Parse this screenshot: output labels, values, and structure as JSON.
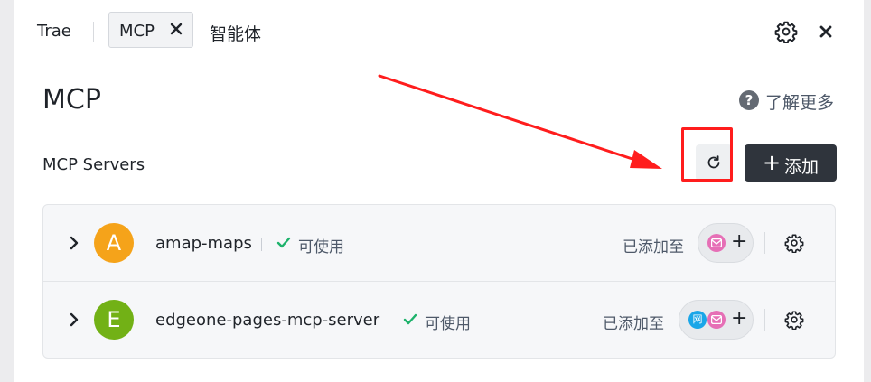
{
  "tabs": {
    "trae": "Trae",
    "mcp": "MCP",
    "agent": "智能体"
  },
  "header": {
    "title": "MCP",
    "learn_more": "了解更多",
    "help_symbol": "?"
  },
  "section": {
    "title": "MCP Servers",
    "add_label": "添加",
    "add_symbol": "+"
  },
  "servers": [
    {
      "initial": "A",
      "name": "amap-maps",
      "status": "可使用",
      "added_to": "已添加至",
      "avatar_color": "#f5a31a",
      "agents": [
        {
          "color": "#e66fb6"
        }
      ]
    },
    {
      "initial": "E",
      "name": "edgeone-pages-mcp-server",
      "status": "可使用",
      "added_to": "已添加至",
      "avatar_color": "#72b116",
      "agents": [
        {
          "glyph": "网",
          "color": "#1aa6e8"
        },
        {
          "color": "#e66fb6"
        }
      ]
    }
  ],
  "plus_symbol": "+",
  "colors": {
    "status_ok": "#1db26b",
    "primary_button": "#2f343c",
    "annotation": "#ff1d1d"
  }
}
